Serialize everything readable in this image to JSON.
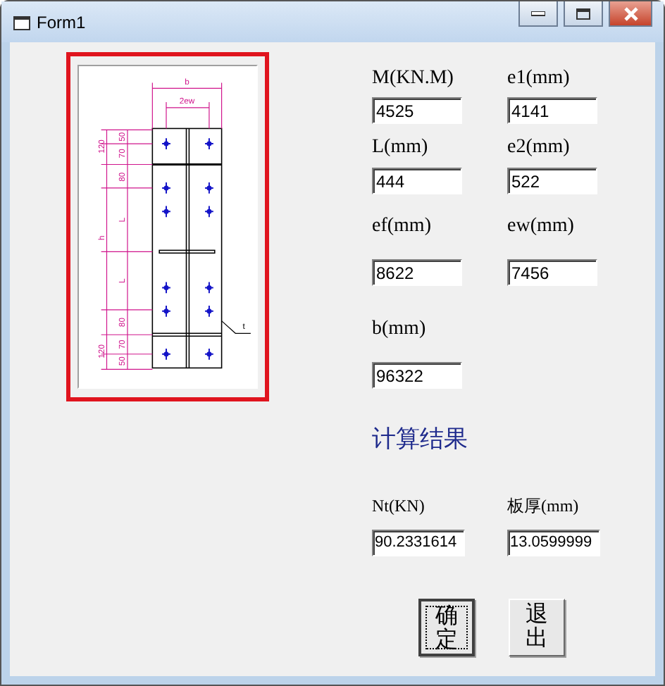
{
  "window": {
    "title": "Form1"
  },
  "drawing_labels": [
    "b",
    "2ew",
    "50",
    "70",
    "120",
    "80",
    "L",
    "h",
    "L",
    "80",
    "120",
    "70",
    "50",
    "t"
  ],
  "fields": [
    {
      "label": "M(KN.M)",
      "value": "4525"
    },
    {
      "label": "e1(mm)",
      "value": "4141"
    },
    {
      "label": "L(mm)",
      "value": "444"
    },
    {
      "label": "e2(mm)",
      "value": "522"
    },
    {
      "label": "ef(mm)",
      "value": "8622"
    },
    {
      "label": "ew(mm)",
      "value": "7456"
    },
    {
      "label": "b(mm)",
      "value": "96322"
    }
  ],
  "results_title": "计算结果",
  "results": [
    {
      "label": "Nt(KN)",
      "value": "90.2331614"
    },
    {
      "label": "板厚(mm)",
      "value": "13.0599999"
    }
  ],
  "buttons": [
    {
      "label": "确定",
      "focused": true
    },
    {
      "label": "退出",
      "focused": false
    }
  ]
}
